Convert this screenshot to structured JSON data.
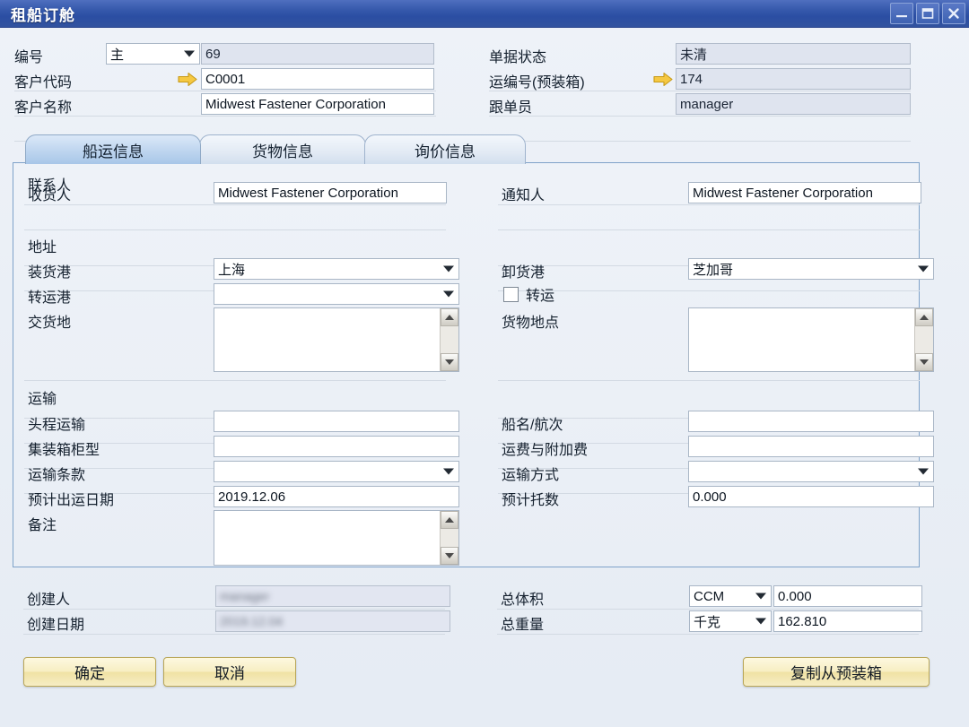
{
  "window": {
    "title": "租船订舱",
    "controls": [
      {
        "name": "minimize",
        "glyph": "minimize-icon"
      },
      {
        "name": "maximize",
        "glyph": "maximize-icon"
      },
      {
        "name": "close",
        "glyph": "close-icon"
      }
    ],
    "titlebar_color": "#2b4ea3"
  },
  "header": {
    "rows_left": [
      {
        "label": "编号",
        "type": "combo+readonly",
        "combo_value": "主",
        "value": "69"
      },
      {
        "label": "客户代码",
        "type": "arrow+input",
        "value": "C0001"
      },
      {
        "label": "客户名称",
        "type": "input",
        "value": "Midwest Fastener Corporation"
      }
    ],
    "rows_right": [
      {
        "label": "单据状态",
        "type": "readonly",
        "value": "未清"
      },
      {
        "label": "运编号(预装箱)",
        "type": "arrow+readonly",
        "value": "174"
      },
      {
        "label": "跟单员",
        "type": "readonly",
        "value": "manager"
      }
    ]
  },
  "tabs": [
    {
      "label": "船运信息",
      "active": true
    },
    {
      "label": "货物信息",
      "active": false
    },
    {
      "label": "询价信息",
      "active": false
    }
  ],
  "panel": {
    "sections": [
      {
        "caption": "联系人"
      },
      {
        "caption": "地址"
      },
      {
        "caption": "运输"
      }
    ],
    "contact": {
      "consignee_label": "收货人",
      "consignee_value": "Midwest Fastener Corporation",
      "notify_label": "通知人",
      "notify_value": "Midwest Fastener Corporation"
    },
    "address": {
      "load_port_label": "装货港",
      "load_port_value": "上海",
      "discharge_port_label": "卸货港",
      "discharge_port_value": "芝加哥",
      "transship_port_label": "转运港",
      "transship_port_value": "",
      "transship_check_label": "转运",
      "transship_checked": false,
      "delivery_place_label": "交货地",
      "delivery_place_value": "",
      "cargo_location_label": "货物地点",
      "cargo_location_value": ""
    },
    "transport": {
      "precarriage_label": "头程运输",
      "precarriage_value": "",
      "vessel_voyage_label": "船名/航次",
      "vessel_voyage_value": "",
      "container_type_label": "集装箱柜型",
      "container_type_value": "",
      "freight_charges_label": "运费与附加费",
      "freight_charges_value": "",
      "terms_label": "运输条款",
      "terms_value": "",
      "mode_label": "运输方式",
      "mode_value": "",
      "etd_label": "预计出运日期",
      "etd_value": "2019.12.06",
      "est_pallets_label": "预计托数",
      "est_pallets_value": "0.000",
      "remark_label": "备注",
      "remark_value": ""
    }
  },
  "footer": {
    "creator_label": "创建人",
    "creator_value": "manager",
    "create_date_label": "创建日期",
    "create_date_value": "2019.12.04",
    "total_volume_label": "总体积",
    "total_volume_unit": "CCM",
    "total_volume_value": "0.000",
    "total_weight_label": "总重量",
    "total_weight_unit": "千克",
    "total_weight_value": "162.810"
  },
  "buttons": {
    "confirm": "确定",
    "cancel": "取消",
    "copy_from_prepack": "复制从预装箱"
  }
}
